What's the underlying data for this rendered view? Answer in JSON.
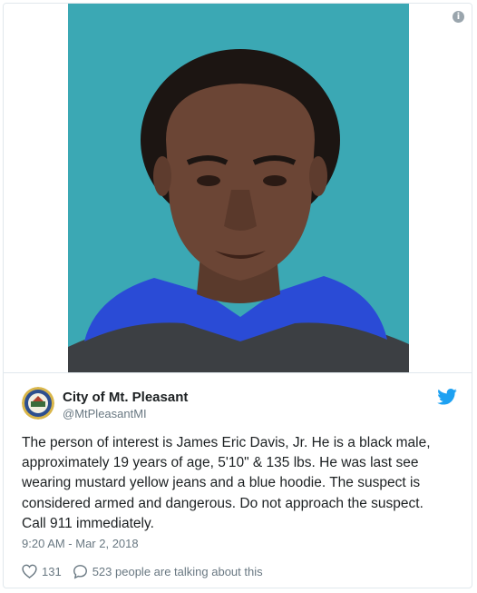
{
  "media": {
    "info_icon_label": "i"
  },
  "user": {
    "name": "City of Mt. Pleasant",
    "handle": "@MtPleasantMI"
  },
  "tweet": {
    "lines": [
      "The person of interest is James Eric Davis, Jr. He is a black male,",
      "approximately 19 years of age, 5'10\" & 135 lbs. He was last see",
      "wearing mustard yellow jeans and a blue hoodie. The suspect is",
      "considered armed and dangerous. Do not approach the suspect.",
      "Call 911 immediately."
    ],
    "timestamp": "9:20 AM - Mar 2, 2018"
  },
  "actions": {
    "like_count": "131",
    "conversation_text": "523 people are talking about this"
  },
  "colors": {
    "photo_background": "#3ba8b4",
    "hoodie_blue": "#2a4bd6",
    "twitter_blue": "#1da1f2",
    "secondary_text": "#697882"
  },
  "icons": [
    "info-icon",
    "twitter-bird-icon",
    "heart-icon",
    "speech-bubble-icon",
    "city-seal-icon"
  ]
}
